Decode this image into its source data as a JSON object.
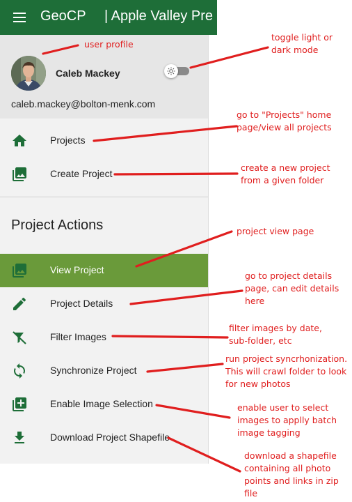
{
  "appbar": {
    "app_name": "GeoCP",
    "project_title": "| Apple Valley Pre"
  },
  "profile": {
    "name": "Caleb Mackey",
    "email": "caleb.mackey@bolton-menk.com"
  },
  "nav": {
    "items": [
      {
        "label": "Projects",
        "icon": "home-icon"
      },
      {
        "label": "Create Project",
        "icon": "photo-library-icon"
      }
    ]
  },
  "project_actions": {
    "header": "Project Actions",
    "items": [
      {
        "label": "View Project",
        "icon": "photo-library-icon",
        "active": true
      },
      {
        "label": "Project Details",
        "icon": "pencil-icon"
      },
      {
        "label": "Filter Images",
        "icon": "filter-off-icon"
      },
      {
        "label": "Synchronize Project",
        "icon": "sync-icon"
      },
      {
        "label": "Enable Image Selection",
        "icon": "library-add-icon"
      },
      {
        "label": "Download Project Shapefile",
        "icon": "download-icon"
      }
    ]
  },
  "annotations": {
    "user_profile": "user profile",
    "toggle_mode": [
      "toggle light or",
      "dark mode"
    ],
    "projects": [
      "go to \"Projects\" home",
      "page/view all projects"
    ],
    "create_project": [
      "create a new project",
      "from a given folder"
    ],
    "view_project": "project view page",
    "project_details": [
      "go to project details",
      "page, can edit details",
      "here"
    ],
    "filter_images": [
      "filter images by date,",
      "sub-folder, etc"
    ],
    "synchronize": [
      "run project syncrhonization.",
      "This will crawl folder to look",
      "for new photos"
    ],
    "enable_selection": [
      "enable user to select",
      "images to applly batch",
      "image tagging"
    ],
    "download_shapefile": [
      "download a shapefile",
      "containing all photo",
      "points and links in zip",
      "file"
    ]
  },
  "colors": {
    "appbar": "#1e6e38",
    "active_item": "#6a9a3a",
    "icon": "#1e6e38",
    "annotation": "#e01e1e"
  }
}
